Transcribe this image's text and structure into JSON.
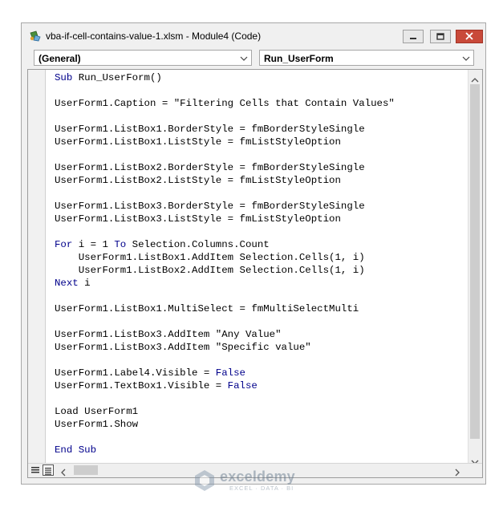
{
  "window": {
    "title": "vba-if-cell-contains-value-1.xlsm - Module4 (Code)"
  },
  "combos": {
    "object": "(General)",
    "procedure": "Run_UserForm"
  },
  "code_lines": [
    [
      {
        "t": "Sub",
        "k": 1
      },
      {
        "t": " Run_UserForm()"
      }
    ],
    [],
    [
      {
        "t": "UserForm1.Caption = \"Filtering Cells that Contain Values\""
      }
    ],
    [],
    [
      {
        "t": "UserForm1.ListBox1.BorderStyle = fmBorderStyleSingle"
      }
    ],
    [
      {
        "t": "UserForm1.ListBox1.ListStyle = fmListStyleOption"
      }
    ],
    [],
    [
      {
        "t": "UserForm1.ListBox2.BorderStyle = fmBorderStyleSingle"
      }
    ],
    [
      {
        "t": "UserForm1.ListBox2.ListStyle = fmListStyleOption"
      }
    ],
    [],
    [
      {
        "t": "UserForm1.ListBox3.BorderStyle = fmBorderStyleSingle"
      }
    ],
    [
      {
        "t": "UserForm1.ListBox3.ListStyle = fmListStyleOption"
      }
    ],
    [],
    [
      {
        "t": "For",
        "k": 1
      },
      {
        "t": " i = 1 "
      },
      {
        "t": "To",
        "k": 1
      },
      {
        "t": " Selection.Columns.Count"
      }
    ],
    [
      {
        "t": "    UserForm1.ListBox1.AddItem Selection.Cells(1, i)"
      }
    ],
    [
      {
        "t": "    UserForm1.ListBox2.AddItem Selection.Cells(1, i)"
      }
    ],
    [
      {
        "t": "Next",
        "k": 1
      },
      {
        "t": " i"
      }
    ],
    [],
    [
      {
        "t": "UserForm1.ListBox1.MultiSelect = fmMultiSelectMulti"
      }
    ],
    [],
    [
      {
        "t": "UserForm1.ListBox3.AddItem \"Any Value\""
      }
    ],
    [
      {
        "t": "UserForm1.ListBox3.AddItem \"Specific value\""
      }
    ],
    [],
    [
      {
        "t": "UserForm1.Label4.Visible = "
      },
      {
        "t": "False",
        "k": 1
      }
    ],
    [
      {
        "t": "UserForm1.TextBox1.Visible = "
      },
      {
        "t": "False",
        "k": 1
      }
    ],
    [],
    [
      {
        "t": "Load UserForm1"
      }
    ],
    [
      {
        "t": "UserForm1.Show"
      }
    ],
    [],
    [
      {
        "t": "End Sub",
        "k": 1
      }
    ]
  ],
  "watermark": {
    "name": "exceldemy",
    "tagline": "EXCEL · DATA · BI"
  },
  "colors": {
    "keyword": "#00008b",
    "close_button": "#c94a3a"
  },
  "icons": [
    "excel-vba-icon",
    "minimize-icon",
    "maximize-icon",
    "close-icon",
    "chevron-down-icon",
    "scroll-up-icon",
    "scroll-down-icon",
    "scroll-left-icon",
    "scroll-right-icon",
    "procedure-view-icon",
    "full-module-view-icon"
  ]
}
